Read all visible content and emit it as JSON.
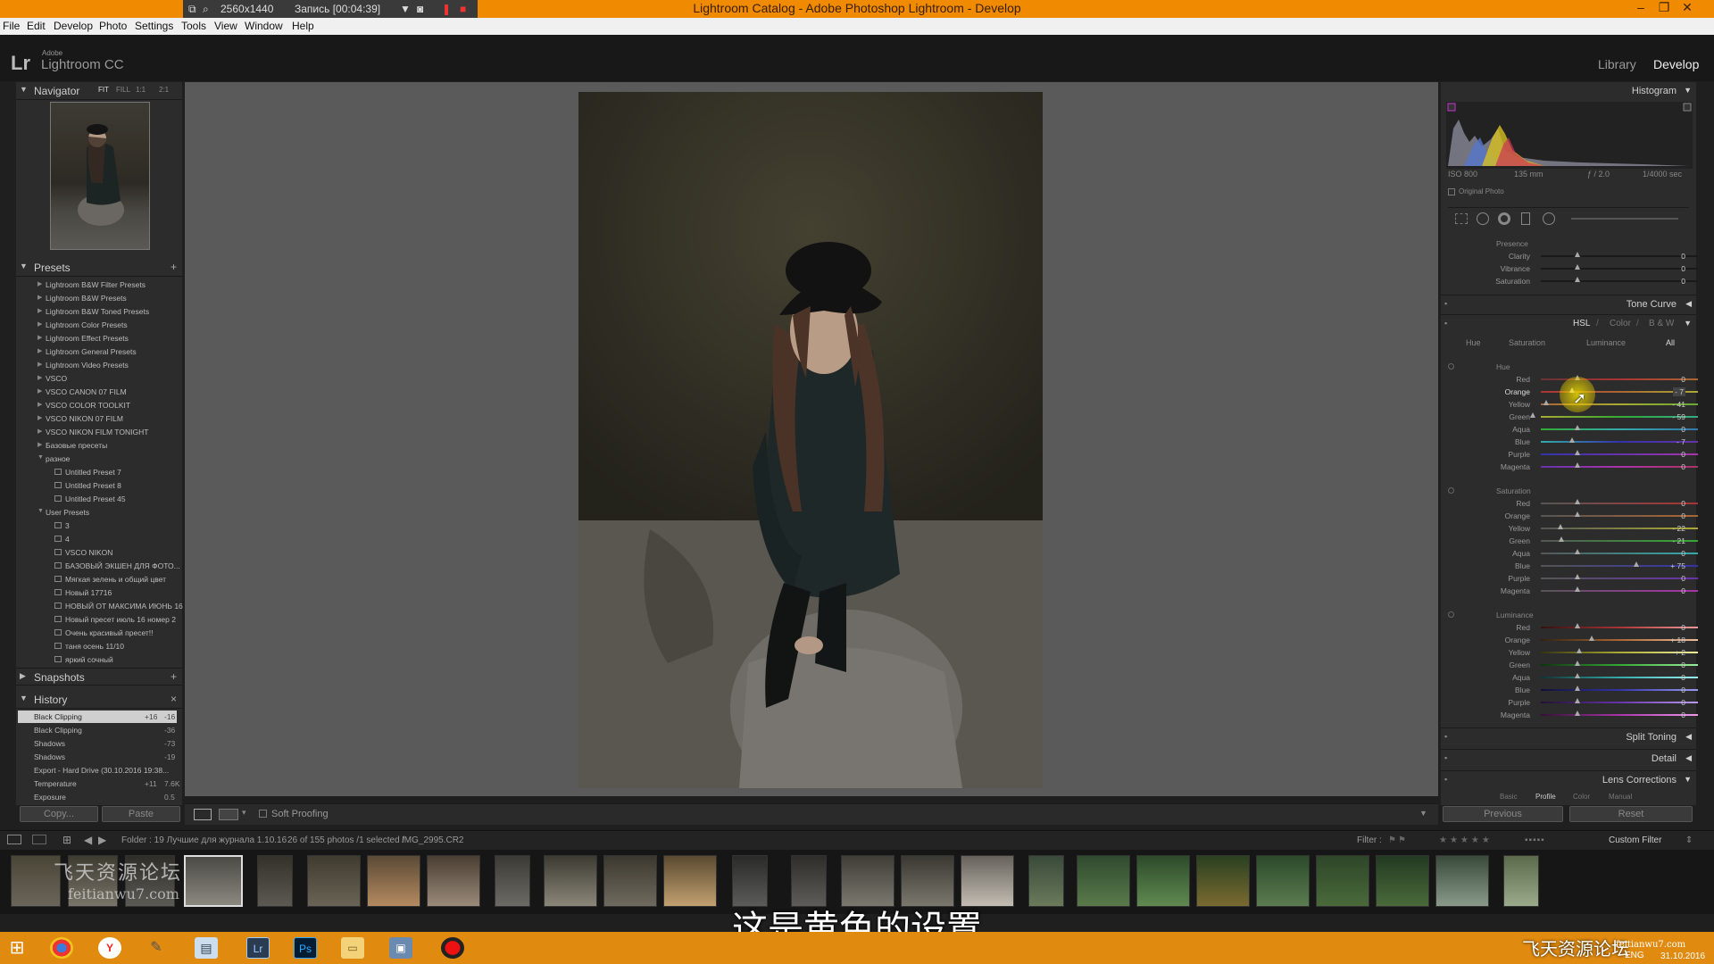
{
  "window": {
    "title": "Lightroom Catalog - Adobe Photoshop Lightroom - Develop"
  },
  "recorder": {
    "resolution": "2560x1440",
    "status": "Запись [00:04:39]"
  },
  "menu": [
    "File",
    "Edit",
    "Develop",
    "Photo",
    "Settings",
    "Tools",
    "View",
    "Window",
    "Help"
  ],
  "brand": {
    "small": "Adobe",
    "name": "Lightroom CC",
    "logo": "Lr"
  },
  "modules": [
    "Library",
    "Develop"
  ],
  "navigator": {
    "title": "Navigator",
    "zoom": [
      "FIT",
      "FILL",
      "1:1",
      "2:1"
    ]
  },
  "presets": {
    "title": "Presets",
    "add": "+",
    "groups": [
      "Lightroom B&W Filter Presets",
      "Lightroom B&W Presets",
      "Lightroom B&W Toned Presets",
      "Lightroom Color Presets",
      "Lightroom Effect Presets",
      "Lightroom General Presets",
      "Lightroom Video Presets",
      "VSCO",
      "VSCO CANON 07 FILM",
      "VSCO COLOR TOOLKIT",
      "VSCO NIKON 07 FILM",
      "VSCO NIKON FILM TONIGHT",
      "Базовые пресеты",
      "разное"
    ],
    "razn": [
      "Untitled Preset 7",
      "Untitled Preset 8",
      "Untitled Preset 45"
    ],
    "user_group": "User Presets",
    "user": [
      "3",
      "4",
      "VSCO NIKON",
      "БАЗОВЫЙ ЭКШЕН ДЛЯ ФОТО...",
      "Мягкая зелень и общий цвет",
      "Новый 17716",
      "НОВЫЙ ОТ МАКСИМА ИЮНЬ 16",
      "Новый пресет июль 16 номер 2",
      "Очень красивый пресет!!",
      "таня осень 11/10",
      "яркий сочный"
    ]
  },
  "snapshots": {
    "title": "Snapshots",
    "add": "+"
  },
  "history": {
    "title": "History",
    "close": "×",
    "items": [
      [
        "Black Clipping",
        "+16",
        "-16"
      ],
      [
        "Black Clipping",
        "",
        "-36"
      ],
      [
        "Shadows",
        "",
        "-73"
      ],
      [
        "Shadows",
        "",
        "-19"
      ],
      [
        "Export - Hard Drive (30.10.2016 19:38...",
        "",
        ""
      ],
      [
        "Temperature",
        "+11",
        "7.6K"
      ],
      [
        "Exposure",
        "",
        "0.5"
      ]
    ]
  },
  "left_buttons": {
    "copy": "Copy...",
    "paste": "Paste"
  },
  "toolbar": {
    "soft_proofing": "Soft Proofing"
  },
  "histogram": {
    "title": "Histogram",
    "iso": "ISO 800",
    "focal": "135 mm",
    "aperture": "ƒ / 2.0",
    "shutter": "1/4000 sec",
    "original": "Original Photo"
  },
  "presence": {
    "title": "Presence",
    "rows": [
      [
        "Clarity",
        "0"
      ],
      [
        "Vibrance",
        "0"
      ],
      [
        "Saturation",
        "0"
      ]
    ]
  },
  "tone_curve": "Tone Curve",
  "hsl": {
    "tabs": [
      "HSL",
      "/",
      "Color",
      "/",
      "B & W"
    ],
    "subtabs": [
      "Hue",
      "Saturation",
      "Luminance",
      "All"
    ],
    "hue_title": "Hue",
    "hue": [
      [
        "Red",
        "0"
      ],
      [
        "Orange",
        "- 7"
      ],
      [
        "Yellow",
        "- 41"
      ],
      [
        "Green",
        "- 59"
      ],
      [
        "Aqua",
        "0"
      ],
      [
        "Blue",
        "- 7"
      ],
      [
        "Purple",
        "0"
      ],
      [
        "Magenta",
        "0"
      ]
    ],
    "sat_title": "Saturation",
    "sat": [
      [
        "Red",
        "0"
      ],
      [
        "Orange",
        "0"
      ],
      [
        "Yellow",
        "- 22"
      ],
      [
        "Green",
        "- 21"
      ],
      [
        "Aqua",
        "0"
      ],
      [
        "Blue",
        "+ 75"
      ],
      [
        "Purple",
        "0"
      ],
      [
        "Magenta",
        "0"
      ]
    ],
    "lum_title": "Luminance",
    "lum": [
      [
        "Red",
        "0"
      ],
      [
        "Orange",
        "+ 18"
      ],
      [
        "Yellow",
        "+ 2"
      ],
      [
        "Green",
        "0"
      ],
      [
        "Aqua",
        "0"
      ],
      [
        "Blue",
        "0"
      ],
      [
        "Purple",
        "0"
      ],
      [
        "Magenta",
        "0"
      ]
    ]
  },
  "split_toning": "Split Toning",
  "detail": "Detail",
  "lens": {
    "title": "Lens Corrections",
    "tabs": [
      "Basic",
      "Profile",
      "Color",
      "Manual"
    ]
  },
  "right_buttons": {
    "previous": "Previous",
    "reset": "Reset"
  },
  "filmbar": {
    "folder": "Folder : 19 Лучшие для журнала 1.10.16",
    "count": "26 of 155 photos /1 selected /",
    "file": "IMG_2995.CR2",
    "filter": "Filter :",
    "custom": "Custom Filter"
  },
  "subtitle": "这是黄色的设置",
  "watermark": {
    "top": "飞天资源论坛",
    "bottom": "feitianwu7.com",
    "right": "飞天资源论坛",
    "right_url": "feitianwu7.com",
    "lang": "ENG",
    "date": "31.10.2016"
  },
  "colors": {
    "titlebar": "#f08a00",
    "panel": "#2c2c2c",
    "center": "#5a5a5a",
    "taskbar": "#e08a10"
  }
}
